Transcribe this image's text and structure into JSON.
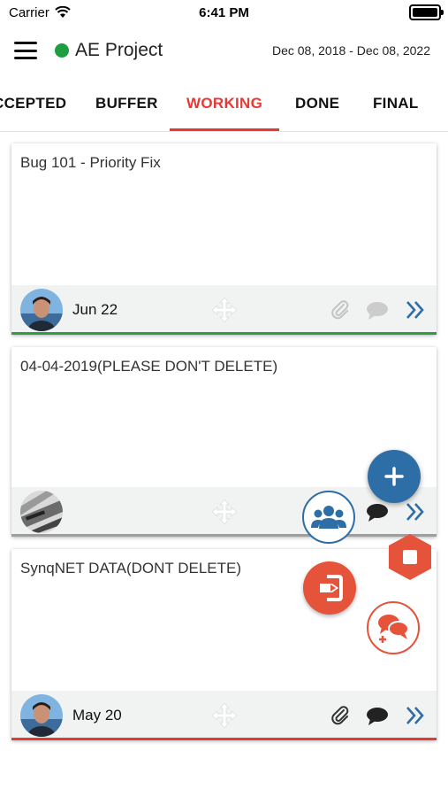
{
  "status": {
    "carrier": "Carrier",
    "time": "6:41 PM"
  },
  "header": {
    "project": "AE Project",
    "dates": "Dec 08, 2018 - Dec 08, 2022",
    "status_color": "#1e9e3e"
  },
  "tabs": [
    {
      "label": "CCEPTED",
      "active": false
    },
    {
      "label": "BUFFER",
      "active": false
    },
    {
      "label": "WORKING",
      "active": true
    },
    {
      "label": "DONE",
      "active": false
    },
    {
      "label": "FINAL",
      "active": false
    }
  ],
  "cards": [
    {
      "title": "Bug 101 - Priority Fix",
      "due": "Jun 22",
      "bar_color": "#2e9d44"
    },
    {
      "title": "04-04-2019(PLEASE DON'T DELETE)",
      "due": "",
      "bar_color": "#9e9e9e"
    },
    {
      "title": "SynqNET DATA(DONT DELETE)",
      "due": "May 20",
      "bar_color": "#e53935"
    }
  ],
  "colors": {
    "accent": "#e53935",
    "blue": "#2e6ea6",
    "orange": "#e5533a"
  },
  "icons": [
    "hamburger-icon",
    "wifi-icon",
    "battery-icon",
    "move-icon",
    "paperclip-icon",
    "chat-icon",
    "double-chevron-icon",
    "plus-icon",
    "team-icon",
    "stop-icon",
    "logout-icon",
    "chat-add-icon"
  ]
}
